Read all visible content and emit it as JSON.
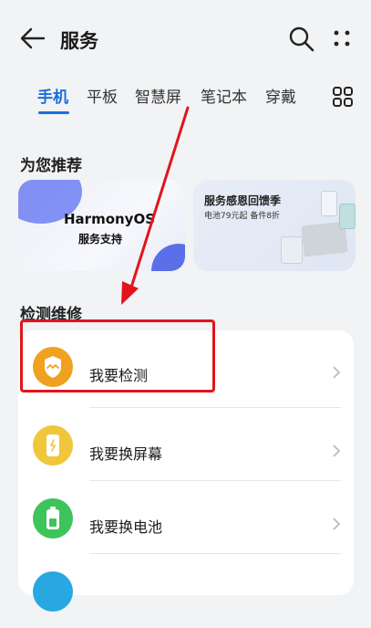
{
  "header": {
    "title": "服务",
    "back_icon": "back-arrow-icon",
    "search_icon": "search-icon",
    "more_icon": "more-vertical-icon"
  },
  "tabs": [
    {
      "label": "手机",
      "active": true
    },
    {
      "label": "平板",
      "active": false
    },
    {
      "label": "智慧屏",
      "active": false
    },
    {
      "label": "笔记本",
      "active": false
    },
    {
      "label": "穿戴",
      "active": false
    }
  ],
  "tab_grid_icon": "grid-icon",
  "recommend": {
    "title": "为您推荐",
    "banner1": {
      "line1": "HarmonyOS",
      "line2": "服务支持"
    },
    "banner2": {
      "line1": "服务感恩回馈季",
      "line2": "电池79元起  备件8折"
    }
  },
  "repair": {
    "title": "检测维修",
    "items": [
      {
        "label": "我要检测",
        "icon": "shield-icon",
        "color": "#f0a11f"
      },
      {
        "label": "我要换屏幕",
        "icon": "phone-screen-icon",
        "color": "#f0c63a"
      },
      {
        "label": "我要换电池",
        "icon": "battery-icon",
        "color": "#3fc45b"
      },
      {
        "label": "",
        "icon": "partial-icon",
        "color": "#27a8e0"
      }
    ]
  },
  "annotation_color": "#e2141c"
}
